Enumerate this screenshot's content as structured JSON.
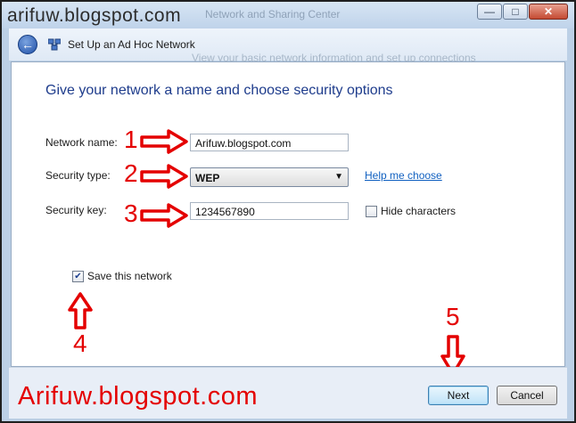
{
  "watermark": {
    "top": "arifuw.blogspot.com",
    "bottom": "Arifuw.blogspot.com"
  },
  "window": {
    "ghost_title": "Network and Sharing Center",
    "ghost_subtitle": "View your basic network information and set up connections",
    "controls": {
      "minimize": "—",
      "maximize": "□",
      "close": "✕"
    }
  },
  "nav": {
    "back_icon": "back-arrow-icon",
    "network_icon": "network-icon",
    "title": "Set Up an Ad Hoc Network"
  },
  "main": {
    "heading": "Give your network a name and choose security options",
    "network_name": {
      "label": "Network name:",
      "value": "Arifuw.blogspot.com"
    },
    "security_type": {
      "label": "Security type:",
      "value": "WEP",
      "help_link": "Help me choose"
    },
    "security_key": {
      "label": "Security key:",
      "value": "1234567890",
      "hide_characters_label": "Hide characters",
      "hide_characters_checked": false
    },
    "save_network": {
      "label": "Save this network",
      "checked": true
    }
  },
  "annotations": {
    "n1": "1",
    "n2": "2",
    "n3": "3",
    "n4": "4",
    "n5": "5",
    "color": "#e40000"
  },
  "footer": {
    "next_label": "Next",
    "cancel_label": "Cancel"
  }
}
